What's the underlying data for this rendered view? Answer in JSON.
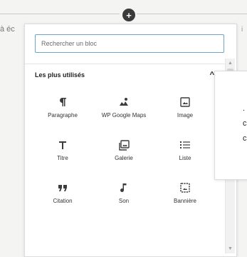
{
  "background": {
    "left_text": "à éc",
    "right_text": "i"
  },
  "inserter_toggle": {
    "glyph": "+"
  },
  "search": {
    "value": "",
    "placeholder": "Rechercher un bloc"
  },
  "panel": {
    "title": "Les plus utilisés",
    "collapse_glyph": "^"
  },
  "blocks": [
    {
      "label": "Paragraphe",
      "icon": "paragraph-icon"
    },
    {
      "label": "WP Google Maps",
      "icon": "maps-icon"
    },
    {
      "label": "Image",
      "icon": "image-icon"
    },
    {
      "label": "Titre",
      "icon": "heading-icon"
    },
    {
      "label": "Galerie",
      "icon": "gallery-icon"
    },
    {
      "label": "Liste",
      "icon": "list-icon"
    },
    {
      "label": "Citation",
      "icon": "quote-icon"
    },
    {
      "label": "Son",
      "icon": "audio-icon"
    },
    {
      "label": "Bannière",
      "icon": "cover-icon"
    }
  ],
  "preview": {
    "lines": [
      ".",
      "c",
      "c"
    ]
  },
  "colors": {
    "search_border": "#6fa3c9",
    "icon": "#3c3c3c"
  }
}
